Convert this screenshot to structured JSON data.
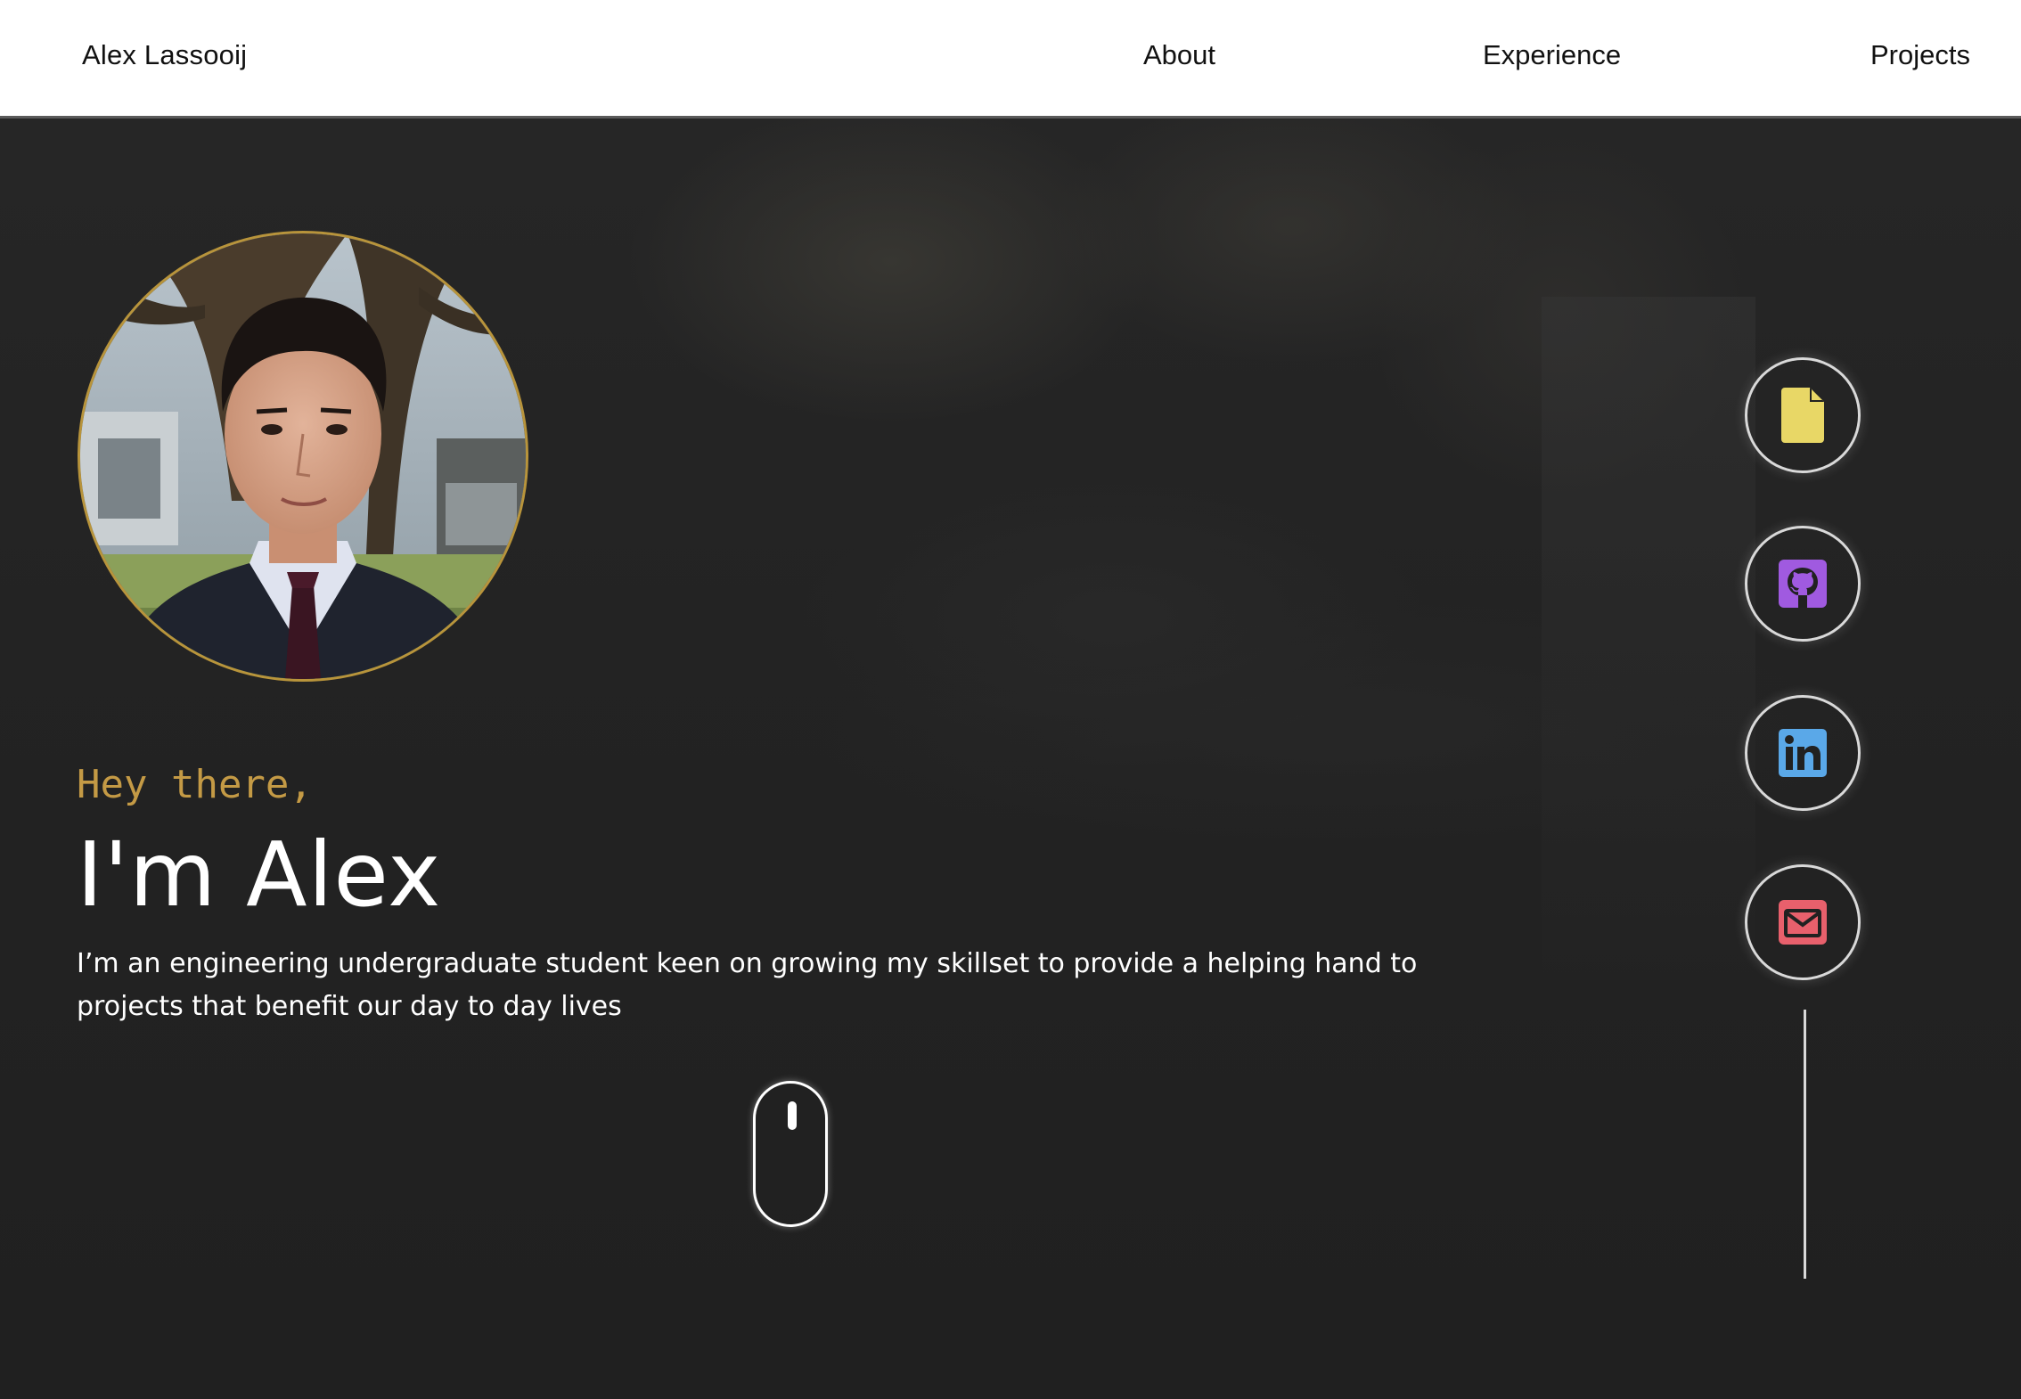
{
  "nav": {
    "brand": "Alex Lassooij",
    "links": [
      {
        "label": "About"
      },
      {
        "label": "Experience"
      },
      {
        "label": "Projects"
      }
    ]
  },
  "hero": {
    "greeting": "Hey there,",
    "headline": "I'm Alex",
    "bio": "I’m an engineering undergraduate student keen on growing my skillset to provide a helping hand to projects that benefit our day to day lives"
  },
  "social": [
    {
      "icon": "file-icon",
      "color": "#e8d766"
    },
    {
      "icon": "github-icon",
      "color": "#a05ae0"
    },
    {
      "icon": "linkedin-icon",
      "color": "#5aa8e8"
    },
    {
      "icon": "mail-icon",
      "color": "#e8606c"
    }
  ],
  "colors": {
    "accent": "#c49a45",
    "background": "#212121",
    "nav_background": "#ffffff"
  }
}
